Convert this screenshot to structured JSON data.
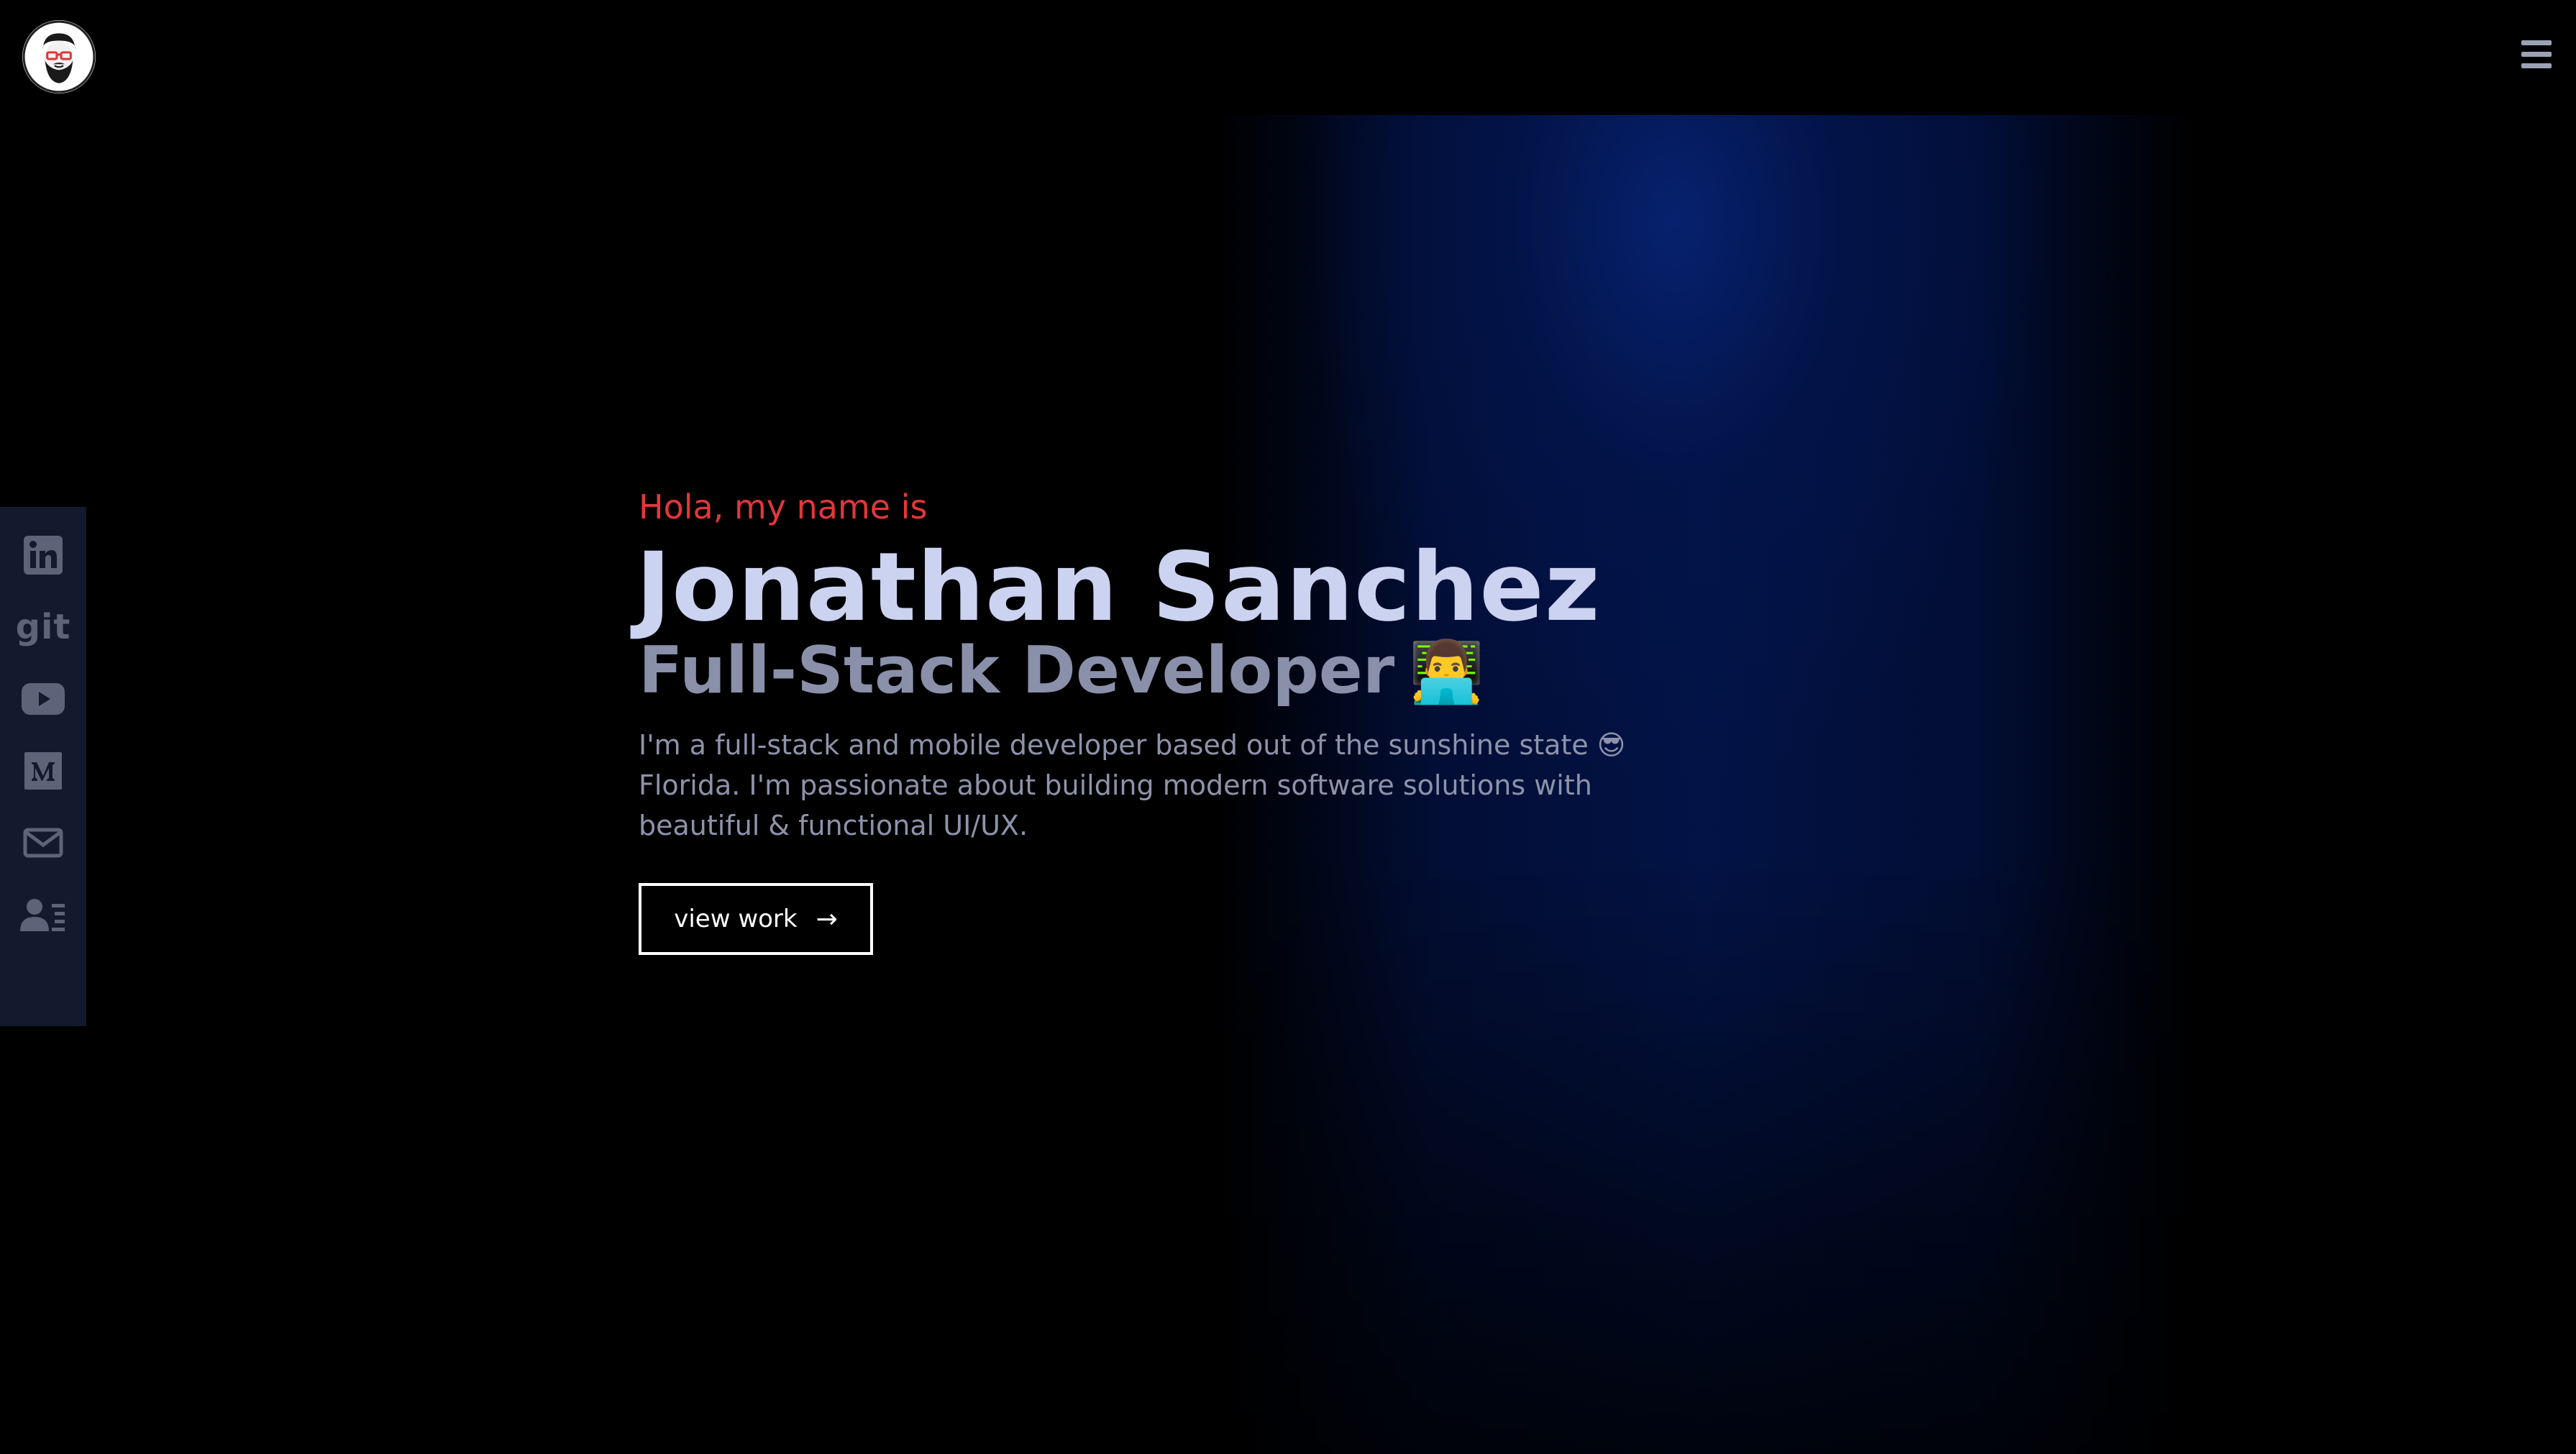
{
  "header": {
    "logo_icon": "bearded-avatar-with-red-glasses",
    "menu_icon": "hamburger-menu-icon"
  },
  "social": [
    {
      "name": "linkedin",
      "icon": "linkedin-icon"
    },
    {
      "name": "git",
      "label": "git",
      "icon": "git-icon"
    },
    {
      "name": "youtube",
      "icon": "youtube-icon"
    },
    {
      "name": "medium",
      "icon": "medium-icon"
    },
    {
      "name": "email",
      "icon": "mail-icon"
    },
    {
      "name": "resume",
      "icon": "contact-card-icon"
    }
  ],
  "hero": {
    "greeting": "Hola, my name is",
    "name": "Jonathan Sanchez",
    "role": "Full-Stack Developer",
    "role_emoji": "👨‍💻",
    "bio": "I'm a full-stack and mobile developer based out of the sunshine state 😎 Florida.   I'm passionate about building modern software solutions with beautiful & functional UI/UX.",
    "cta_label": "view work",
    "cta_arrow": "→"
  },
  "colors": {
    "background": "#000000",
    "accent_red": "#e2373b",
    "name": "#cbd3f1",
    "role": "#8a90aa",
    "body_text": "#8d93aa",
    "sidebar": "#131a2d",
    "glow_blue": "#062270"
  }
}
